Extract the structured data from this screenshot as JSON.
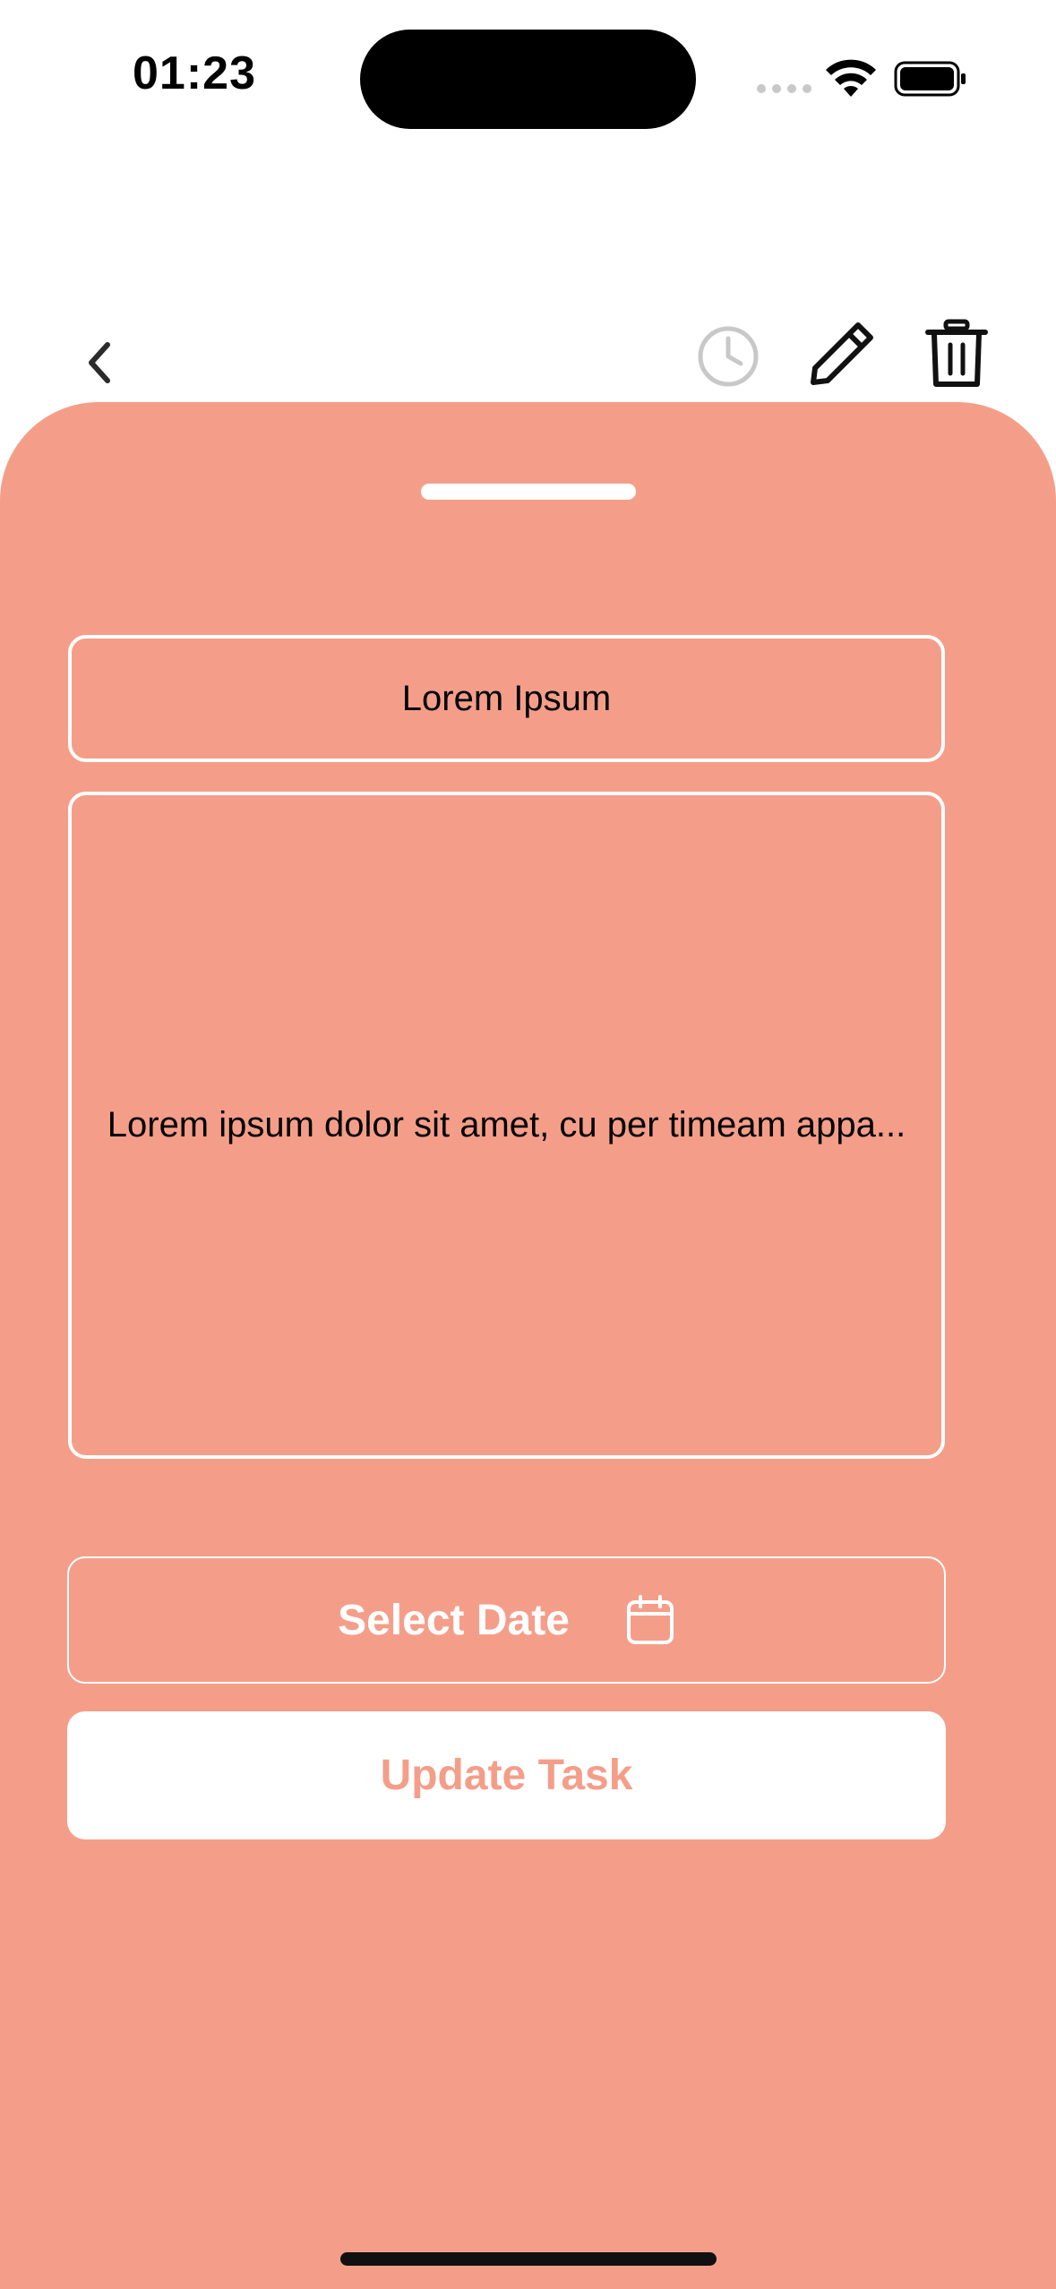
{
  "status_bar": {
    "time": "01:23",
    "icons": [
      "cellular-signal-icon",
      "wifi-icon",
      "battery-icon"
    ]
  },
  "toolbar": {
    "icons": [
      "back-chevron-icon",
      "clock-icon",
      "pencil-icon",
      "trash-icon"
    ]
  },
  "form": {
    "title_value": "Lorem Ipsum",
    "description_value": "Lorem ipsum dolor sit amet, cu per timeam appa...",
    "select_date_label": "Select Date",
    "select_date_icon": "calendar-icon",
    "update_button_label": "Update Task"
  },
  "colors": {
    "accent": "#f49e8a",
    "background": "#ffffff",
    "text": "#000000"
  }
}
